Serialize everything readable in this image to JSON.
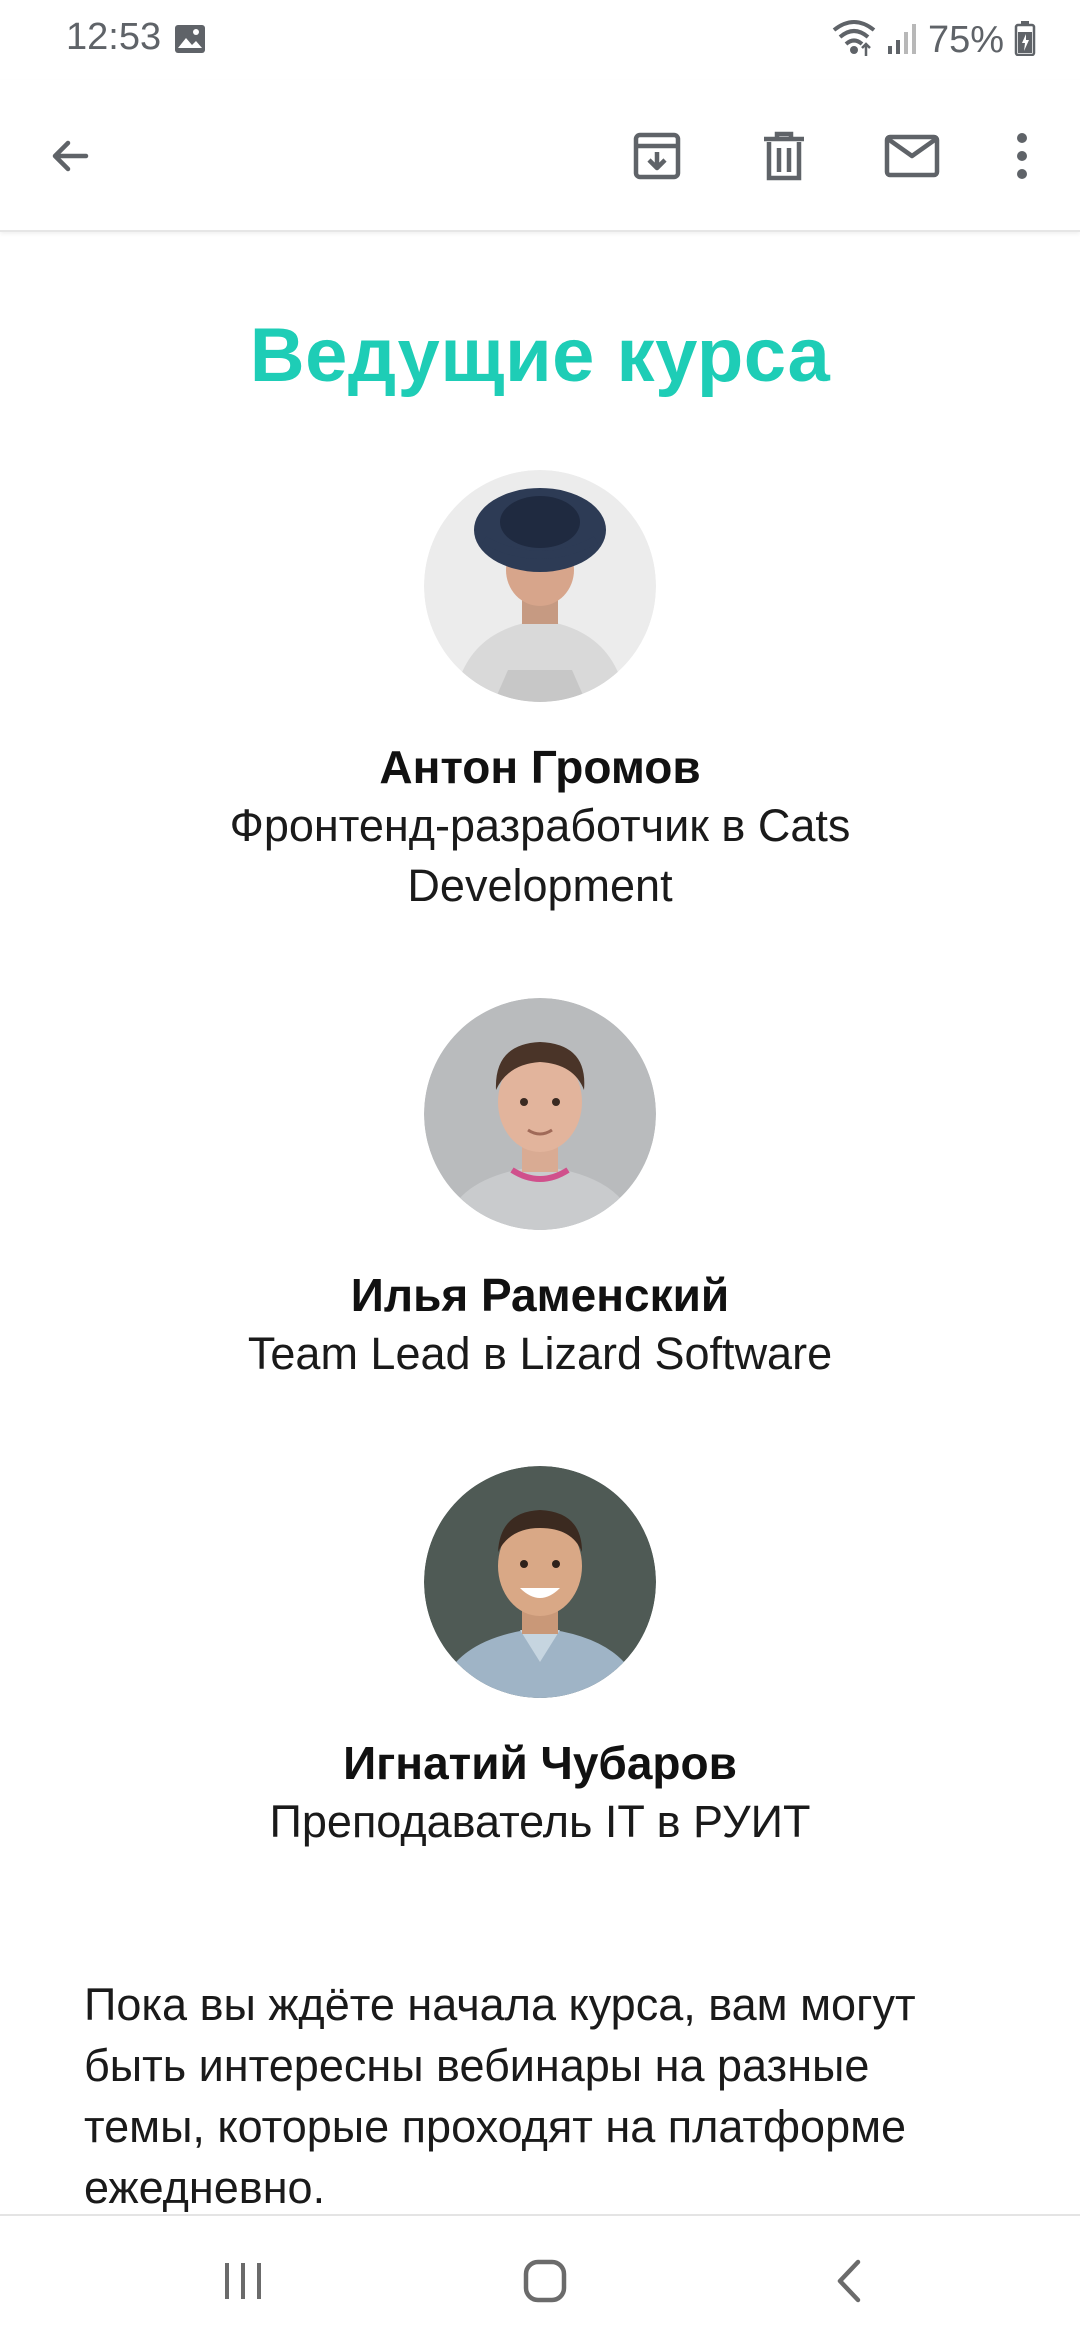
{
  "status_bar": {
    "time": "12:53",
    "battery_percent": "75%",
    "icons": [
      "gallery-icon",
      "wifi-icon",
      "signal-icon",
      "battery-icon"
    ]
  },
  "app_bar": {
    "icons": [
      "arrow-back-icon",
      "archive-icon",
      "delete-icon",
      "mail-unread-icon",
      "more-vert-icon"
    ]
  },
  "email": {
    "section_title": "Ведущие курса",
    "teachers": [
      {
        "name": "Антон Громов",
        "role": "Фронтенд-разработчик в Cats Development"
      },
      {
        "name": "Илья Раменский",
        "role": "Team Lead в Lizard Software"
      },
      {
        "name": "Игнатий Чубаров",
        "role": "Преподаватель IT в РУИТ"
      }
    ],
    "paragraph": "Пока вы ждёте начала курса, вам могут быть интересны вебинары на разные темы, которые проходят на платформе ежедневно."
  },
  "nav_bar": {
    "icons": [
      "recents-icon",
      "home-icon",
      "back-icon"
    ]
  },
  "colors": {
    "accent": "#1ecdb6",
    "icon_gray": "#5f6368"
  }
}
